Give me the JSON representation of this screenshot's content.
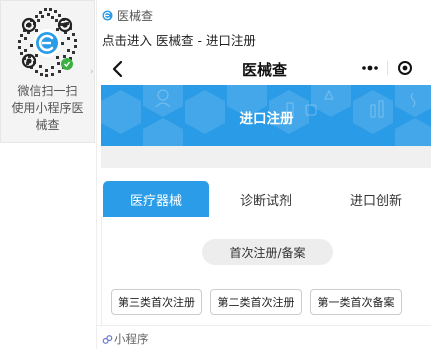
{
  "qr_panel": {
    "caption_line1": "微信扫一扫",
    "caption_line2": "使用小程序医",
    "caption_line3": "械查"
  },
  "card": {
    "brand_name": "医械查",
    "subtitle": "点击进入 医械查 - 进口注册"
  },
  "mini_header": {
    "title": "医械查",
    "back_icon": "chevron-left-icon",
    "more_icon": "more-dots-icon",
    "close_icon": "target-close-icon"
  },
  "banner": {
    "title": "进口注册",
    "color": "#2a9be6"
  },
  "tabs": [
    {
      "label": "医疗器械",
      "active": true
    },
    {
      "label": "诊断试剂",
      "active": false
    },
    {
      "label": "进口创新",
      "active": false
    }
  ],
  "content": {
    "section_label": "首次注册/备案",
    "category_buttons": [
      {
        "label": "第三类首次注册"
      },
      {
        "label": "第二类首次注册"
      },
      {
        "label": "第一类首次备案"
      }
    ]
  },
  "footer": {
    "label": "小程序"
  },
  "colors": {
    "accent": "#2b9de8",
    "tab_active_bg": "#2b9de8",
    "section_bg": "#ededed"
  }
}
